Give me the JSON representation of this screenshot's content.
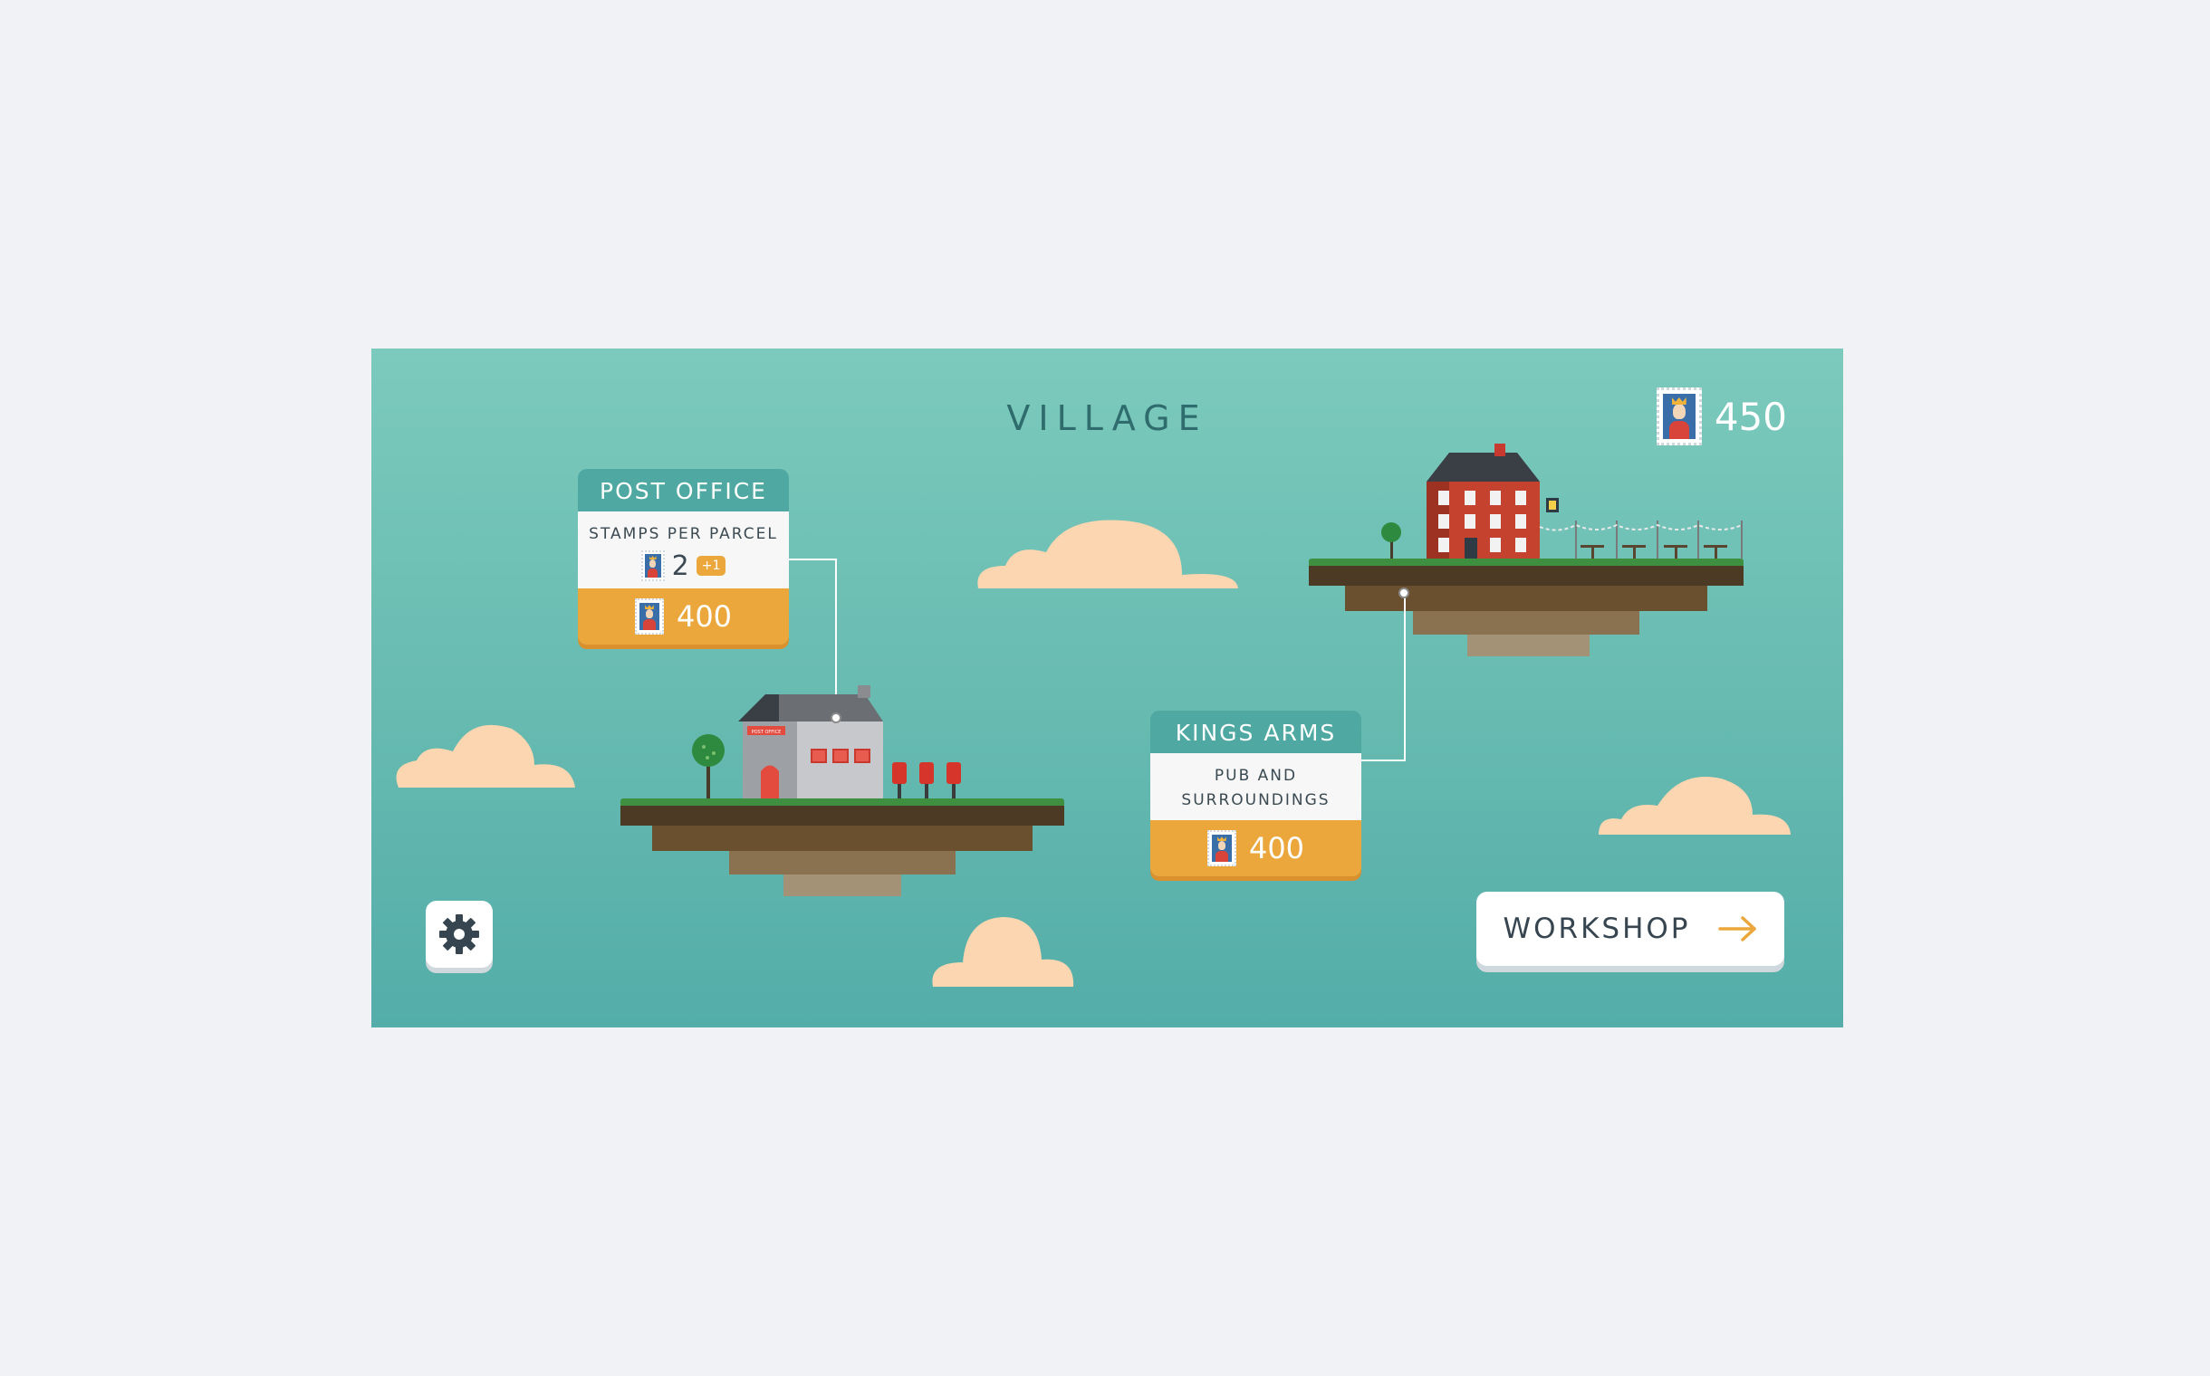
{
  "scene": {
    "title": "VILLAGE",
    "currency": {
      "value": "450",
      "icon": "stamp-icon"
    }
  },
  "buildings": [
    {
      "name": "POST OFFICE",
      "description": "STAMPS PER PARCEL",
      "stat_value": "2",
      "stat_bonus": "+1",
      "price": "400"
    },
    {
      "name": "KINGS ARMS",
      "description_line1": "PUB AND",
      "description_line2": "SURROUNDINGS",
      "price": "400"
    }
  ],
  "post_office_sign": "POST OFFICE",
  "controls": {
    "settings_icon": "gear-icon",
    "workshop_label": "WORKSHOP",
    "workshop_icon": "arrow-right-icon"
  },
  "colors": {
    "sky_top": "#7ccabd",
    "sky_bottom": "#54ada9",
    "accent_orange": "#eba73c",
    "card_header_teal": "#4fa8a2",
    "cloud": "#fbd6b0"
  }
}
